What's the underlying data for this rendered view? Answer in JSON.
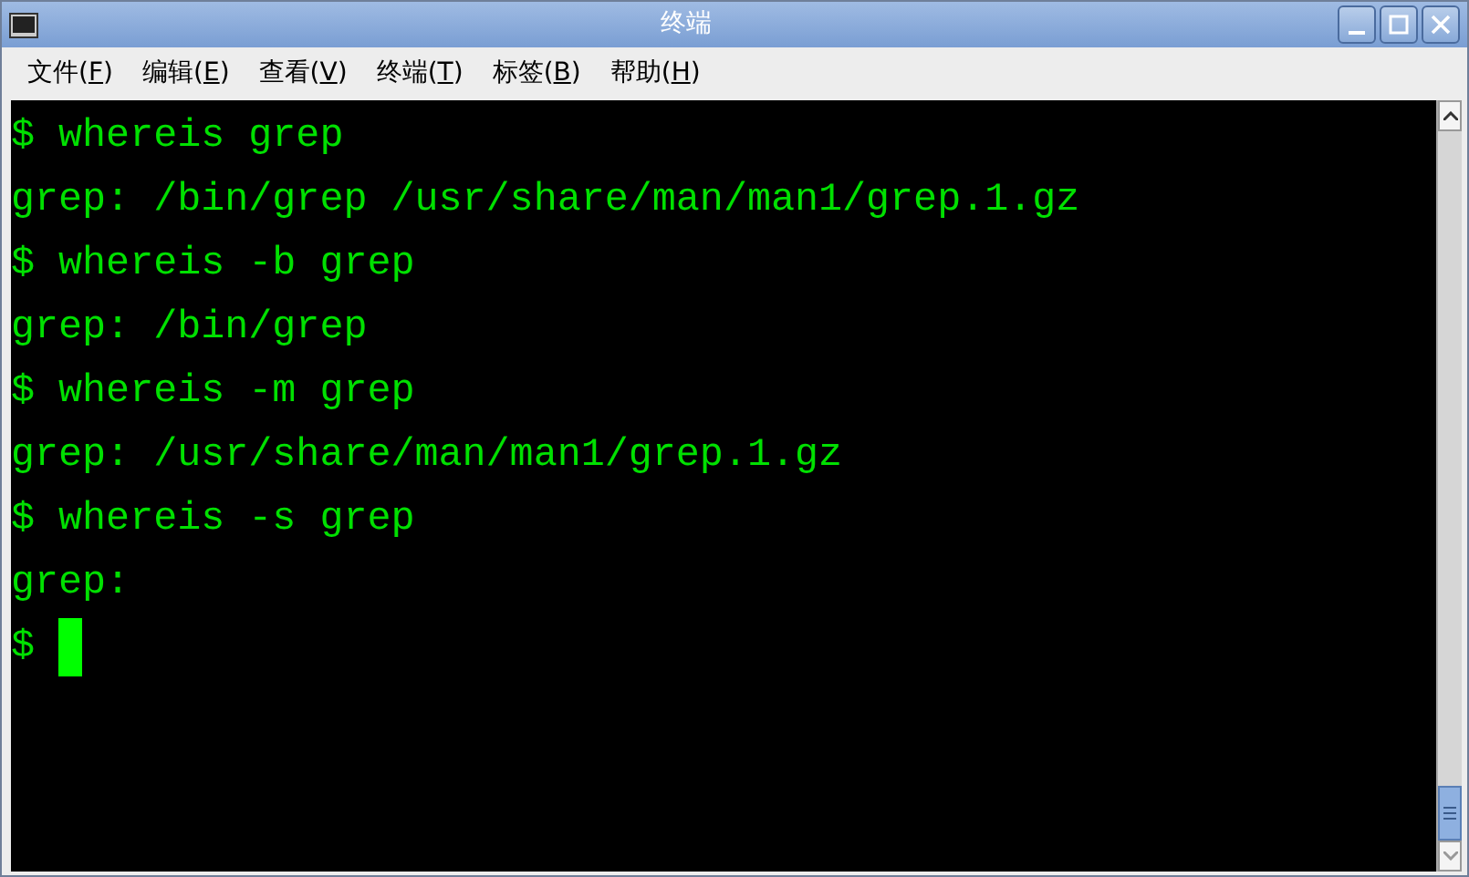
{
  "window": {
    "title": "终端"
  },
  "menu": [
    {
      "before": "文件(",
      "key": "F",
      "after": ")"
    },
    {
      "before": "编辑(",
      "key": "E",
      "after": ")"
    },
    {
      "before": "查看(",
      "key": "V",
      "after": ")"
    },
    {
      "before": "终端(",
      "key": "T",
      "after": ")"
    },
    {
      "before": "标签(",
      "key": "B",
      "after": ")"
    },
    {
      "before": "帮助(",
      "key": "H",
      "after": ")"
    }
  ],
  "terminal": {
    "lines": [
      {
        "kind": "command",
        "text": "$ whereis grep"
      },
      {
        "kind": "output",
        "text": "grep: /bin/grep /usr/share/man/man1/grep.1.gz"
      },
      {
        "kind": "command",
        "text": "$ whereis -b grep"
      },
      {
        "kind": "output",
        "text": "grep: /bin/grep"
      },
      {
        "kind": "command",
        "text": "$ whereis -m grep"
      },
      {
        "kind": "output",
        "text": "grep: /usr/share/man/man1/grep.1.gz"
      },
      {
        "kind": "command",
        "text": "$ whereis -s grep"
      },
      {
        "kind": "output",
        "text": "grep:"
      },
      {
        "kind": "prompt",
        "text": "$"
      }
    ]
  }
}
